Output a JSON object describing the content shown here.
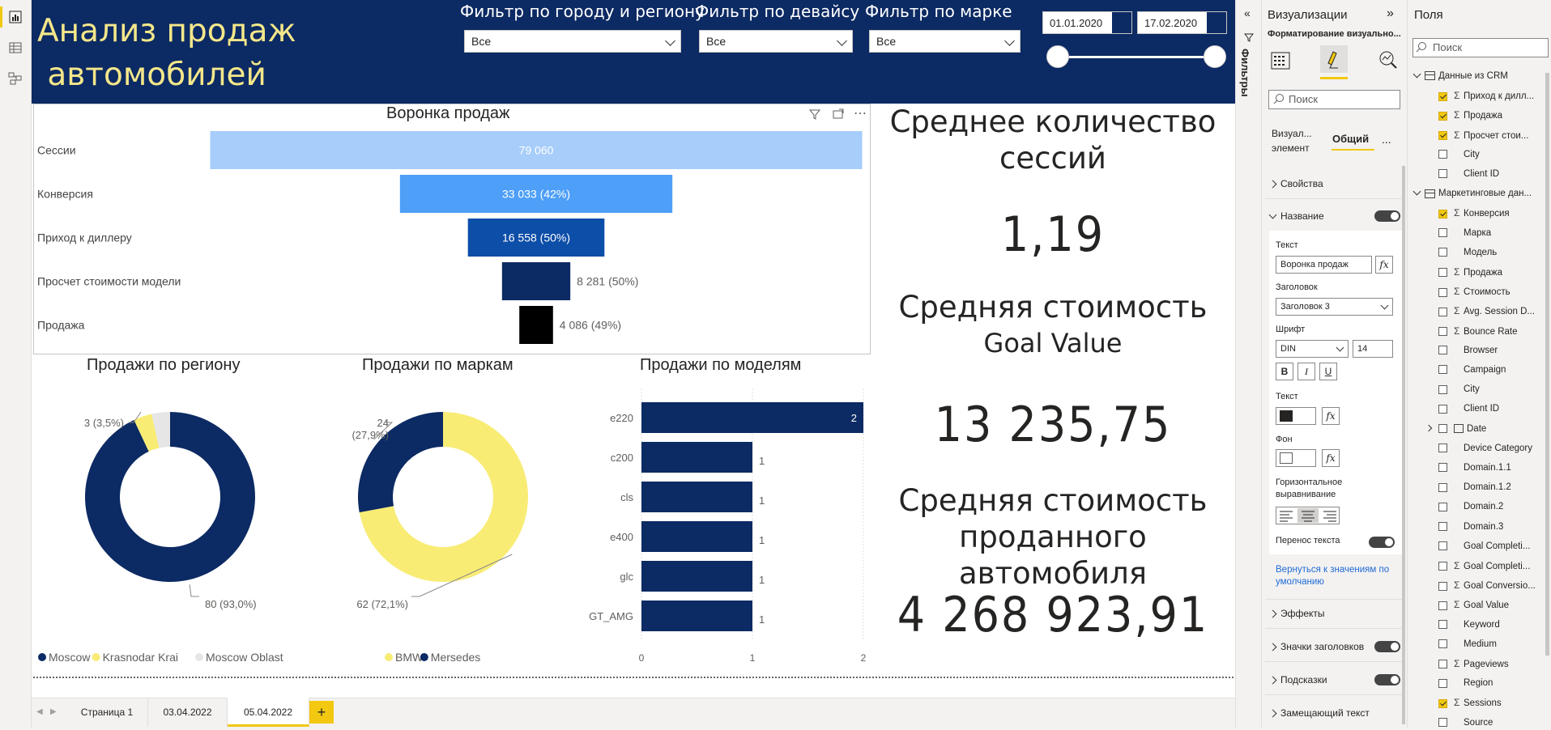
{
  "report": {
    "title": "Анализ продаж\n автомобилей"
  },
  "slicers": {
    "city": {
      "title": "Фильтр по городу и региону",
      "value": "Все"
    },
    "device": {
      "title": "Фильтр по девайсу",
      "value": "Все"
    },
    "brand": {
      "title": "Фильтр по марке",
      "value": "Все"
    },
    "date_from": "01.01.2020",
    "date_to": "17.02.2020"
  },
  "funnel": {
    "title": "Воронка продаж"
  },
  "kpis": [
    {
      "label": "Среднее количество сессий",
      "value": "1,19"
    },
    {
      "label": "Средняя стоимость",
      "sublabel": "Goal Value",
      "value": "13 235,75"
    },
    {
      "label": "Средняя стоимость проданного автомобиля",
      "value": "4 268 923,91"
    }
  ],
  "chart_data": [
    {
      "type": "bar",
      "subtype": "funnel",
      "title": "Воронка продаж",
      "categories": [
        "Сессии",
        "Конверсия",
        "Приход к диллеру",
        "Просчет стоимости модели",
        "Продажа"
      ],
      "values": [
        79060,
        33033,
        16558,
        8281,
        4086
      ],
      "data_labels": [
        "79 060",
        "33 033 (42%)",
        "16 558 (50%)",
        "8 281 (50%)",
        "4 086 (49%)"
      ],
      "colors": [
        "#a7cdfb",
        "#4d9ff7",
        "#0d4ea8",
        "#0c2a63",
        "#000000"
      ]
    },
    {
      "type": "pie",
      "subtype": "donut",
      "title": "Продажи по региону",
      "categories": [
        "Moscow",
        "Krasnodar Krai",
        "Moscow Oblast"
      ],
      "values": [
        80,
        3,
        3
      ],
      "data_labels": [
        "80 (93,0%)",
        "3 (3,5%)",
        ""
      ],
      "colors": [
        "#0c2a63",
        "#f8ec75",
        "#e6e6e6"
      ],
      "legend": "bottom-left"
    },
    {
      "type": "pie",
      "subtype": "donut",
      "title": "Продажи по маркам",
      "categories": [
        "BMW",
        "Mersedes"
      ],
      "values": [
        62,
        24
      ],
      "data_labels": [
        "62 (72,1%)",
        "24 (27,9%)"
      ],
      "colors": [
        "#f8ec75",
        "#0c2a63"
      ],
      "legend": "bottom-left"
    },
    {
      "type": "bar",
      "orientation": "horizontal",
      "title": "Продажи по моделям",
      "categories": [
        "e220",
        "c200",
        "cls",
        "e400",
        "glc",
        "GT_AMG"
      ],
      "values": [
        2,
        1,
        1,
        1,
        1,
        1
      ],
      "xlim": [
        0,
        2
      ],
      "xticks": [
        "0",
        "1",
        "2"
      ],
      "color": "#0c2a63"
    }
  ],
  "tabs": [
    "Страница 1",
    "03.04.2022",
    "05.04.2022"
  ],
  "active_tab": "05.04.2022",
  "filters_label": "Фильтры",
  "viz_pane": {
    "title": "Визуализации",
    "subtitle": "Форматирование визуально...",
    "search_placeholder": "Поиск",
    "tab_visual": "Визуал... элемент",
    "tab_general": "Общий",
    "more": "...",
    "sections": {
      "properties": "Свойства",
      "name": "Название",
      "effects": "Эффекты",
      "header_icons": "Значки заголовков",
      "tooltips": "Подсказки",
      "alt_text": "Замещающий текст"
    },
    "name_section": {
      "text_label": "Текст",
      "text_value": "Воронка продаж",
      "heading_label": "Заголовок",
      "heading_value": "Заголовок 3",
      "font_label": "Шрифт",
      "font_value": "DIN",
      "font_size": "14",
      "bold": "B",
      "italic": "I",
      "underline": "U",
      "color_label": "Текст",
      "bg_label": "Фон",
      "align_label": "Горизонтальное выравнивание",
      "wrap_label": "Перенос текста",
      "fx": "fx"
    },
    "reset_link": "Вернуться к значениям по умолчанию"
  },
  "fields_pane": {
    "title": "Поля",
    "search_placeholder": "Поиск",
    "tables": [
      {
        "name": "Данные из CRM",
        "fields": [
          {
            "name": "Приход к дилл...",
            "sigma": true,
            "checked": true
          },
          {
            "name": "Продажа",
            "sigma": true,
            "checked": true
          },
          {
            "name": "Просчет стои...",
            "sigma": true,
            "checked": true
          },
          {
            "name": "City",
            "sigma": false,
            "checked": false
          },
          {
            "name": "Client ID",
            "sigma": false,
            "checked": false
          }
        ]
      },
      {
        "name": "Маркетинговые дан...",
        "fields": [
          {
            "name": "Конверсия",
            "sigma": true,
            "checked": true
          },
          {
            "name": "Марка",
            "sigma": false,
            "checked": false
          },
          {
            "name": "Модель",
            "sigma": false,
            "checked": false
          },
          {
            "name": "Продажа",
            "sigma": true,
            "checked": false
          },
          {
            "name": "Стоимость",
            "sigma": true,
            "checked": false
          },
          {
            "name": "Avg. Session D...",
            "sigma": true,
            "checked": false
          },
          {
            "name": "Bounce Rate",
            "sigma": true,
            "checked": false
          },
          {
            "name": "Browser",
            "sigma": false,
            "checked": false
          },
          {
            "name": "Campaign",
            "sigma": false,
            "checked": false
          },
          {
            "name": "City",
            "sigma": false,
            "checked": false
          },
          {
            "name": "Client ID",
            "sigma": false,
            "checked": false
          },
          {
            "name": "Date",
            "sigma": false,
            "checked": false,
            "date": true
          },
          {
            "name": "Device Category",
            "sigma": false,
            "checked": false
          },
          {
            "name": "Domain.1.1",
            "sigma": false,
            "checked": false
          },
          {
            "name": "Domain.1.2",
            "sigma": false,
            "checked": false
          },
          {
            "name": "Domain.2",
            "sigma": false,
            "checked": false
          },
          {
            "name": "Domain.3",
            "sigma": false,
            "checked": false
          },
          {
            "name": "Goal Completi...",
            "sigma": false,
            "checked": false
          },
          {
            "name": "Goal Completi...",
            "sigma": true,
            "checked": false
          },
          {
            "name": "Goal Conversio...",
            "sigma": true,
            "checked": false
          },
          {
            "name": "Goal Value",
            "sigma": true,
            "checked": false
          },
          {
            "name": "Keyword",
            "sigma": false,
            "checked": false
          },
          {
            "name": "Medium",
            "sigma": false,
            "checked": false
          },
          {
            "name": "Pageviews",
            "sigma": true,
            "checked": false
          },
          {
            "name": "Region",
            "sigma": false,
            "checked": false
          },
          {
            "name": "Sessions",
            "sigma": true,
            "checked": true
          },
          {
            "name": "Source",
            "sigma": false,
            "checked": false
          }
        ]
      }
    ]
  }
}
